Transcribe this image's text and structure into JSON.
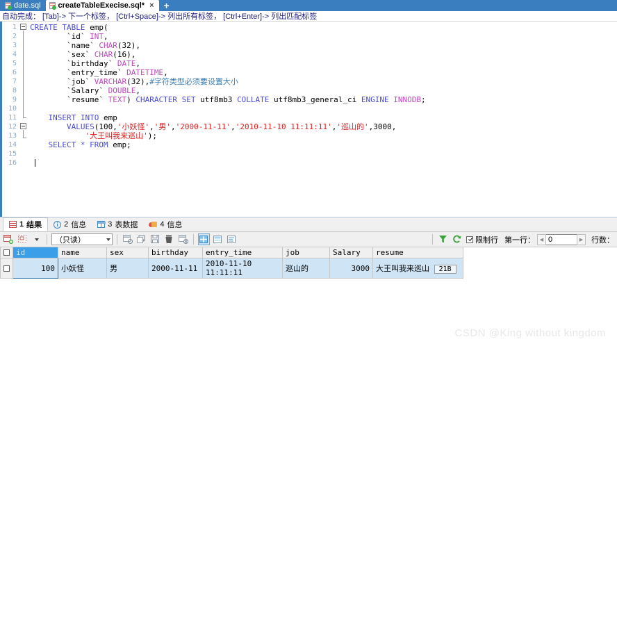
{
  "window": {
    "accent_color": "#3a7ebf",
    "watermark": "CSDN @King without kingdom"
  },
  "tabbar": {
    "tabs": [
      {
        "label": "date.sql",
        "active": false,
        "modified": false,
        "close_label": "×"
      },
      {
        "label": "createTableExecise.sql*",
        "active": true,
        "modified": true,
        "close_label": "×"
      }
    ],
    "add_tab_label": "+"
  },
  "hint": {
    "text": "自动完成： [Tab]-> 下一个标签， [Ctrl+Space]-> 列出所有标签， [Ctrl+Enter]-> 列出匹配标签"
  },
  "editor": {
    "line_numbers": [
      "1",
      "2",
      "3",
      "4",
      "5",
      "6",
      "7",
      "8",
      "9",
      "10",
      "11",
      "12",
      "13",
      "14",
      "15",
      "16"
    ],
    "lines": [
      "CREATE TABLE emp(",
      "        `id` INT,",
      "        `name` CHAR(32),",
      "        `sex` CHAR(16),",
      "        `birthday` DATE,",
      "        `entry_time` DATETIME,",
      "        `job` VARCHAR(32),#字符类型必须要设置大小",
      "        `Salary` DOUBLE,",
      "        `resume` TEXT) CHARACTER SET utf8mb3 COLLATE utf8mb3_general_ci ENGINE INNODB;",
      "",
      "    INSERT INTO emp",
      "        VALUES(100,'小妖怪','男','2000-11-11','2010-11-10 11:11:11','巡山的',3000,",
      "            '大王叫我来巡山');",
      "    SELECT * FROM emp;",
      "",
      ""
    ]
  },
  "results": {
    "tabs": [
      {
        "num": "1",
        "label": "结果",
        "icon": "grid-icon",
        "active": true
      },
      {
        "num": "2",
        "label": "信息",
        "icon": "info-icon",
        "active": false
      },
      {
        "num": "3",
        "label": "表数据",
        "icon": "table-icon",
        "active": false
      },
      {
        "num": "4",
        "label": "信息",
        "icon": "warning-icon",
        "active": false
      }
    ],
    "toolbar": {
      "mode_value": "（只读）",
      "limit_label": "限制行",
      "limit_checked": true,
      "first_row_label": "第一行：",
      "first_row_value": "0",
      "rows_label": "行数：",
      "prev_arrow": "◀",
      "next_arrow": "▶",
      "icons": [
        "add-record-icon",
        "edit-record-icon",
        "dropdown-icon",
        "insert-row-icon",
        "apply-changes-icon",
        "save-icon",
        "delete-row-icon",
        "cancel-edit-icon",
        "grid-view-icon",
        "form-view-icon",
        "text-view-icon",
        "filter-icon",
        "refresh-icon"
      ]
    },
    "grid": {
      "columns": [
        "id",
        "name",
        "sex",
        "birthday",
        "entry_time",
        "job",
        "Salary",
        "resume"
      ],
      "selected_column": "id",
      "rows": [
        {
          "id": "100",
          "name": "小妖怪",
          "sex": "男",
          "birthday": "2000-11-11",
          "entry_time": "2010-11-10 11:11:11",
          "job": "巡山的",
          "Salary": "3000",
          "resume": "大王叫我来巡山",
          "resume_size": "21B"
        }
      ]
    }
  }
}
